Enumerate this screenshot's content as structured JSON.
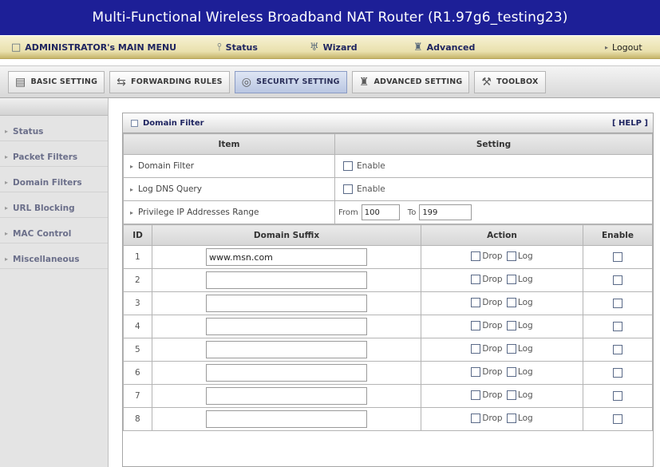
{
  "title": "Multi-Functional Wireless Broadband NAT Router (R1.97g6_testing23)",
  "menu": {
    "main": "ADMINISTRATOR's MAIN MENU",
    "status": "Status",
    "wizard": "Wizard",
    "advanced": "Advanced",
    "logout": "Logout"
  },
  "tabs": [
    {
      "label": "BASIC SETTING",
      "icon": "basic-setting-icon"
    },
    {
      "label": "FORWARDING RULES",
      "icon": "forwarding-rules-icon"
    },
    {
      "label": "SECURITY SETTING",
      "icon": "security-setting-icon"
    },
    {
      "label": "ADVANCED SETTING",
      "icon": "advanced-setting-icon"
    },
    {
      "label": "TOOLBOX",
      "icon": "toolbox-icon"
    }
  ],
  "sidebar": {
    "items": [
      {
        "label": "Status"
      },
      {
        "label": "Packet Filters"
      },
      {
        "label": "Domain Filters"
      },
      {
        "label": "URL Blocking"
      },
      {
        "label": "MAC Control"
      },
      {
        "label": "Miscellaneous"
      }
    ]
  },
  "panel": {
    "title": "Domain Filter",
    "help": "[ HELP ]",
    "col_item": "Item",
    "col_setting": "Setting",
    "domain_filter_label": "Domain Filter",
    "domain_filter_enable": "Enable",
    "log_dns_label": "Log DNS Query",
    "log_dns_enable": "Enable",
    "privilege_label": "Privilege IP Addresses Range",
    "from_label": "From",
    "from_value": "100",
    "to_label": "To",
    "to_value": "199",
    "col_id": "ID",
    "col_domain": "Domain Suffix",
    "col_action": "Action",
    "col_enable": "Enable",
    "drop_label": "Drop",
    "log_label": "Log",
    "rows": [
      {
        "id": "1",
        "domain": "www.msn.com"
      },
      {
        "id": "2",
        "domain": ""
      },
      {
        "id": "3",
        "domain": ""
      },
      {
        "id": "4",
        "domain": ""
      },
      {
        "id": "5",
        "domain": ""
      },
      {
        "id": "6",
        "domain": ""
      },
      {
        "id": "7",
        "domain": ""
      },
      {
        "id": "8",
        "domain": ""
      }
    ]
  }
}
